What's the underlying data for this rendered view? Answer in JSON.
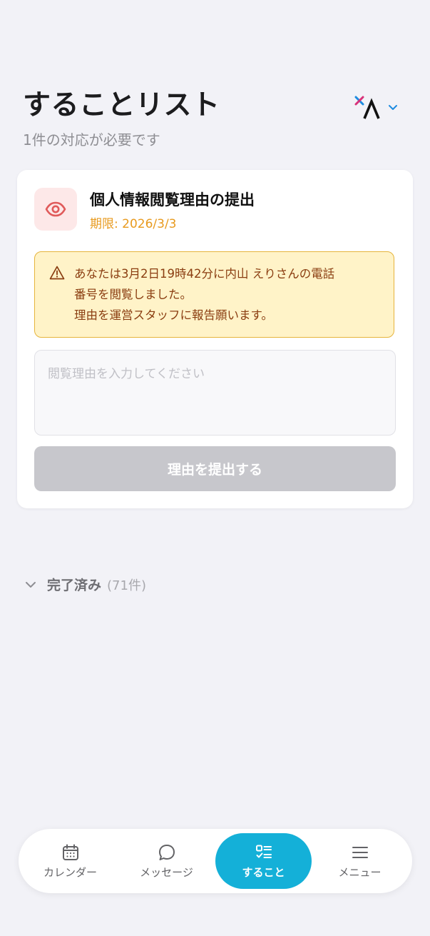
{
  "header": {
    "title": "することリスト",
    "subtitle": "1件の対応が必要です"
  },
  "colors": {
    "background": "#f2f2f7",
    "accent": "#14b0d8",
    "deadline": "#e89a1e",
    "warning_bg": "#fff3c8",
    "warning_border": "#e6b43c",
    "warning_text": "#8a3d10",
    "disabled_button": "#c7c7cc"
  },
  "account_switcher": {
    "logo_icon": "logo-x-lambda-icon",
    "chevron_icon": "chevron-down-icon"
  },
  "task": {
    "icon": "eye-icon",
    "title": "個人情報閲覧理由の提出",
    "deadline": "期限: 2026/3/3",
    "warning": {
      "icon": "warning-triangle-icon",
      "line1": "あなたは3月2日19時42分に内山 えりさんの電話",
      "line2": "番号を閲覧しました。",
      "line3": "理由を運営スタッフに報告願います。"
    },
    "reason_input": {
      "value": "",
      "placeholder": "閲覧理由を入力してください"
    },
    "submit_label": "理由を提出する"
  },
  "completed": {
    "label": "完了済み",
    "count": "(71件)"
  },
  "bottom_nav": {
    "items": [
      {
        "label": "カレンダー",
        "icon": "calendar-icon",
        "active": false
      },
      {
        "label": "メッセージ",
        "icon": "chat-bubble-icon",
        "active": false
      },
      {
        "label": "すること",
        "icon": "checklist-icon",
        "active": true
      },
      {
        "label": "メニュー",
        "icon": "menu-icon",
        "active": false
      }
    ]
  }
}
